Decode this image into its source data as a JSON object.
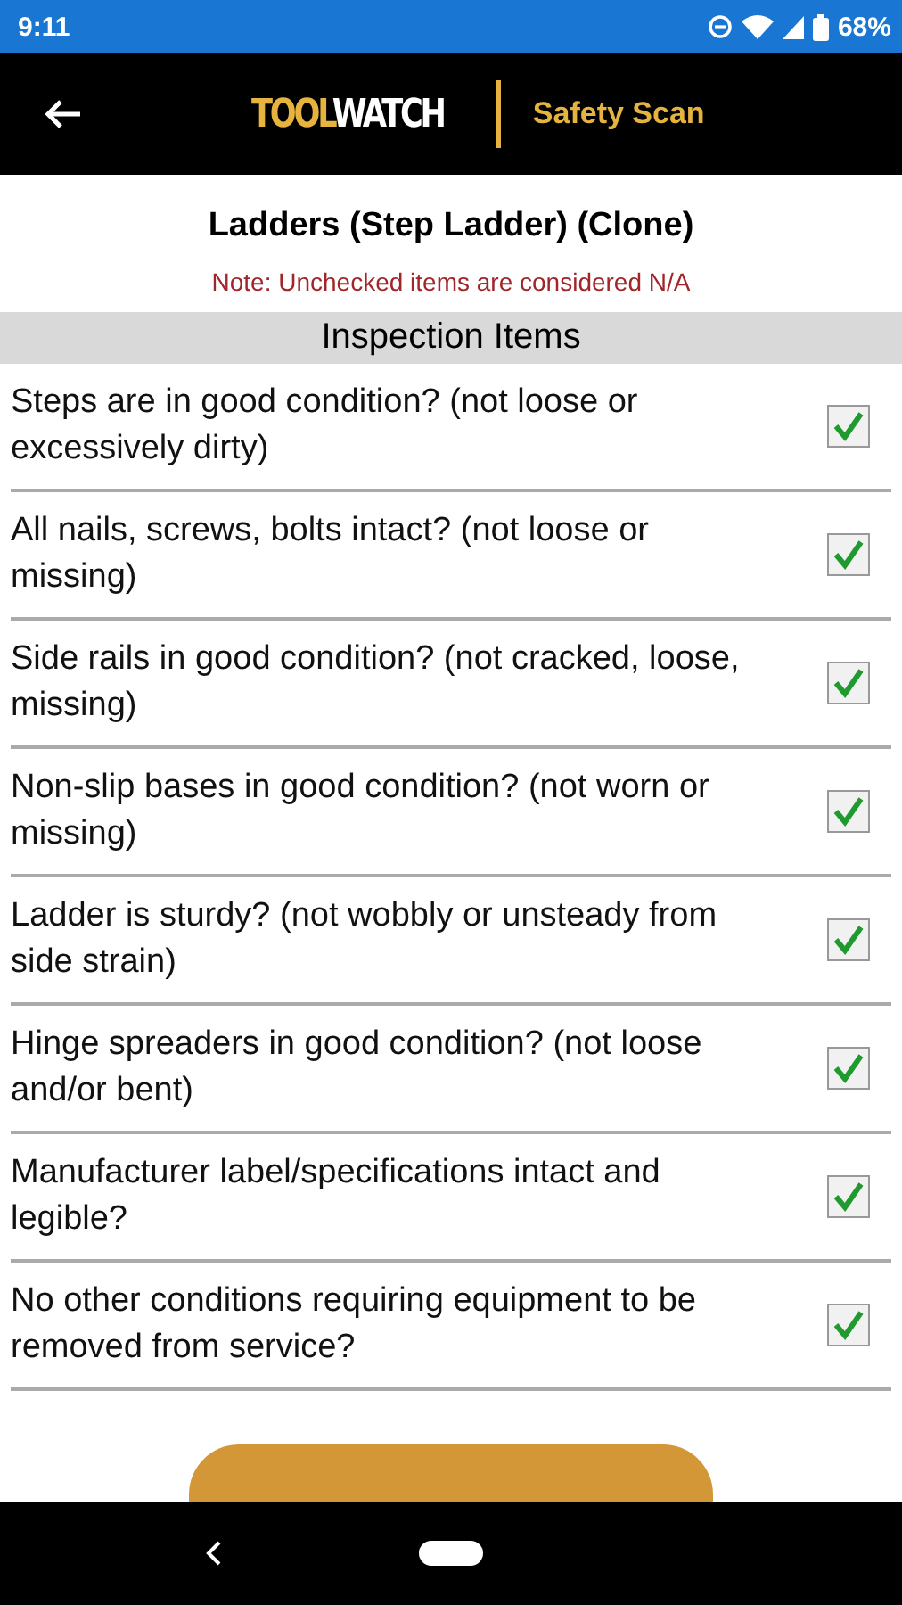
{
  "status_bar": {
    "time": "9:11",
    "battery": "68%"
  },
  "app_bar": {
    "logo": {
      "lead": "TOOL",
      "rest": "WATCH"
    },
    "subtitle": "Safety Scan"
  },
  "title": "Ladders (Step Ladder) (Clone)",
  "note": "Note: Unchecked items are considered N/A",
  "section": "Inspection Items",
  "items": [
    {
      "text": "Steps are in good condition? (not loose or excessively dirty)",
      "checked": true
    },
    {
      "text": "All nails, screws, bolts intact? (not loose or missing)",
      "checked": true
    },
    {
      "text": "Side rails in good condition? (not cracked, loose, missing)",
      "checked": true
    },
    {
      "text": "Non-slip bases in good condition? (not worn or missing)",
      "checked": true
    },
    {
      "text": "Ladder is sturdy? (not wobbly or unsteady from side strain)",
      "checked": true
    },
    {
      "text": "Hinge spreaders in good condition? (not loose and/or bent)",
      "checked": true
    },
    {
      "text": "Manufacturer label/specifications intact and legible?",
      "checked": true
    },
    {
      "text": "No other conditions requiring equipment to be removed from service?",
      "checked": true
    }
  ]
}
